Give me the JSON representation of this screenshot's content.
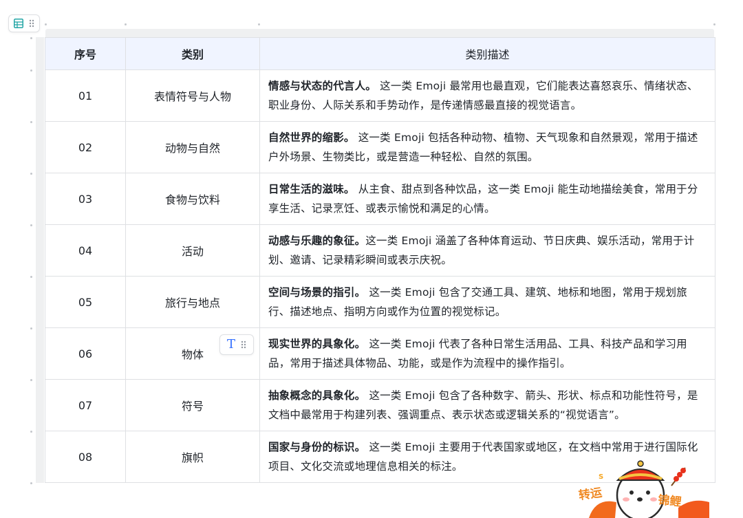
{
  "table": {
    "headers": {
      "num": "序号",
      "category": "类别",
      "description": "类别描述"
    },
    "rows": [
      {
        "num": "01",
        "category": "表情符号与人物",
        "lead": "情感与状态的代言人。",
        "text": " 这一类 Emoji 最常用也最直观，它们能表达喜怒哀乐、情绪状态、职业身份、人际关系和手势动作，是传递情感最直接的视觉语言。"
      },
      {
        "num": "02",
        "category": "动物与自然",
        "lead": "自然世界的缩影。",
        "text": " 这一类 Emoji 包括各种动物、植物、天气现象和自然景观，常用于描述户外场景、生物类比，或是营造一种轻松、自然的氛围。"
      },
      {
        "num": "03",
        "category": "食物与饮料",
        "lead": "日常生活的滋味。",
        "text": " 从主食、甜点到各种饮品，这一类 Emoji 能生动地描绘美食，常用于分享生活、记录烹饪、或表示愉悦和满足的心情。"
      },
      {
        "num": "04",
        "category": "活动",
        "lead": "动感与乐趣的象征。",
        "text": "这一类 Emoji 涵盖了各种体育运动、节日庆典、娱乐活动，常用于计划、邀请、记录精彩瞬间或表示庆祝。"
      },
      {
        "num": "05",
        "category": "旅行与地点",
        "lead": "空间与场景的指引。",
        "text": " 这一类 Emoji 包含了交通工具、建筑、地标和地图，常用于规划旅行、描述地点、指明方向或作为位置的视觉标记。"
      },
      {
        "num": "06",
        "category": "物体",
        "lead": "现实世界的具象化。",
        "text": " 这一类 Emoji 代表了各种日常生活用品、工具、科技产品和学习用品，常用于描述具体物品、功能，或是作为流程中的操作指引。"
      },
      {
        "num": "07",
        "category": "符号",
        "lead": "抽象概念的具象化。",
        "text": " 这一类 Emoji 包含了各种数字、箭头、形状、标点和功能性符号，是文档中最常用于构建列表、强调重点、表示状态或逻辑关系的“视觉语言”。"
      },
      {
        "num": "08",
        "category": "旗帜",
        "lead": "国家与身份的标识。",
        "text": " 这一类 Emoji 主要用于代表国家或地区，在文档中常用于进行国际化项目、文化交流或地理信息相关的标注。"
      }
    ]
  },
  "handles": {
    "type_glyph": "T",
    "drag_glyph": "⠿"
  },
  "sticker": {
    "left_text": "转运",
    "right_text": "锦鲤"
  },
  "colors": {
    "header_bg": "#f0f4ff",
    "border": "#dee0e3",
    "accent": "#3370ff"
  }
}
